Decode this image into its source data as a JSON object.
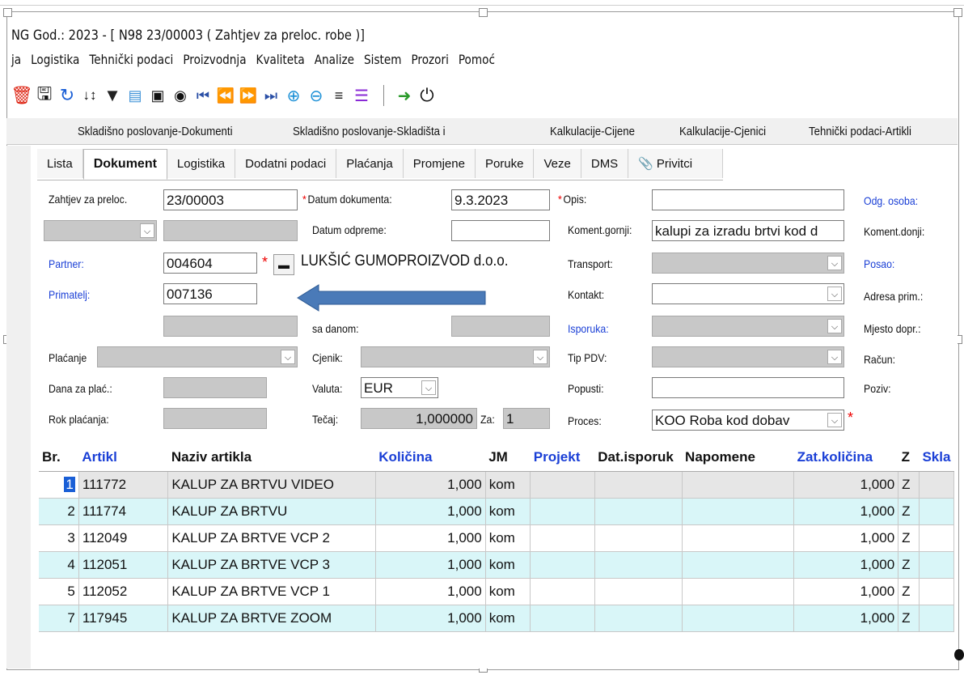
{
  "window": {
    "title": "NG God.: 2023 - [ N98 23/00003  ( Zahtjev za preloc. robe )]"
  },
  "menu": [
    "ja",
    "Logistika",
    "Tehnički podaci",
    "Proizvodnja",
    "Kvaliteta",
    "Analize",
    "Sistem",
    "Prozori",
    "Pomoć"
  ],
  "toolbar": {
    "icons": [
      "delete-icon",
      "save-icon",
      "refresh-icon",
      "sort-icon",
      "filter-icon",
      "edit-grid-icon",
      "layout-icon",
      "view-icon",
      "first-icon",
      "prev-icon",
      "next-icon",
      "last-icon",
      "zoom-in-icon",
      "zoom-out-icon",
      "align-icon",
      "list-icon",
      "exit-icon",
      "power-icon"
    ]
  },
  "window_tabs": [
    "Skladišno poslovanje-Dokumenti",
    "Skladišno poslovanje-Skladišta i",
    "Kalkulacije-Cijene",
    "Kalkulacije-Cjenici",
    "Tehnički podaci-Artikli"
  ],
  "tabs": [
    "Lista",
    "Dokument",
    "Logistika",
    "Dodatni podaci",
    "Plaćanja",
    "Promjene",
    "Poruke",
    "Veze",
    "DMS",
    "Privitci"
  ],
  "form": {
    "zahtjev_label": "Zahtjev za preloc.",
    "zahtjev_value": "23/00003",
    "partner_label": "Partner:",
    "partner_value": "004604",
    "partner_name": "LUKŠIĆ GUMOPROIZVOD d.o.o.",
    "primatelj_label": "Primatelj:",
    "primatelj_value": "007136",
    "placanje_label": "Plaćanje",
    "dana_label": "Dana za plać.:",
    "rok_label": "Rok plaćanja:",
    "datum_dok_label": "Datum dokumenta:",
    "datum_dok_value": "9.3.2023",
    "datum_odpreme_label": "Datum odpreme:",
    "sa_danom_label": "sa danom:",
    "cjenik_label": "Cjenik:",
    "valuta_label": "Valuta:",
    "valuta_value": "EUR",
    "tecaj_label": "Tečaj:",
    "tecaj_value": "1,000000",
    "za_label": "Za:",
    "za_value": "1",
    "opis_label": "Opis:",
    "koment_gornji_label": "Koment.gornji:",
    "koment_gornji_value": "kalupi za izradu brtvi kod d",
    "transport_label": "Transport:",
    "kontakt_label": "Kontakt:",
    "isporuka_label": "Isporuka:",
    "tip_pdv_label": "Tip PDV:",
    "popusti_label": "Popusti:",
    "proces_label": "Proces:",
    "proces_value": "KOO  Roba kod dobav",
    "odg_osoba_label": "Odg. osoba:",
    "koment_donji_label": "Koment.donji:",
    "posao_label": "Posao:",
    "adresa_prim_label": "Adresa prim.:",
    "mjesto_dopr_label": "Mjesto dopr.:",
    "racun_label": "Račun:",
    "poziv_label": "Poziv:"
  },
  "colors": {
    "link_blue": "#1a3fd6",
    "row_cyan": "#d9f6f8",
    "required_red": "#e00000",
    "arrow_blue": "#4a7ab8"
  },
  "grid": {
    "columns": [
      "Br.",
      "Artikl",
      "Naziv artikla",
      "Količina",
      "JM",
      "Projekt",
      "Dat.isporuk",
      "Napomene",
      "Zat.količina",
      "Z",
      "Skla"
    ],
    "rows": [
      {
        "br": "1",
        "artikl": "111772",
        "naziv": "KALUP ZA BRTVU VIDEO",
        "kolicina": "1,000",
        "jm": "kom",
        "zat": "1,000",
        "z": "Z"
      },
      {
        "br": "2",
        "artikl": "111774",
        "naziv": "KALUP ZA BRTVU",
        "kolicina": "1,000",
        "jm": "kom",
        "zat": "1,000",
        "z": "Z"
      },
      {
        "br": "3",
        "artikl": "112049",
        "naziv": "KALUP ZA BRTVE VCP 2",
        "kolicina": "1,000",
        "jm": "kom",
        "zat": "1,000",
        "z": "Z"
      },
      {
        "br": "4",
        "artikl": "112051",
        "naziv": "KALUP ZA BRTVE VCP 3",
        "kolicina": "1,000",
        "jm": "kom",
        "zat": "1,000",
        "z": "Z"
      },
      {
        "br": "5",
        "artikl": "112052",
        "naziv": "KALUP ZA BRTVE VCP 1",
        "kolicina": "1,000",
        "jm": "kom",
        "zat": "1,000",
        "z": "Z"
      },
      {
        "br": "7",
        "artikl": "117945",
        "naziv": "KALUP ZA BRTVE ZOOM",
        "kolicina": "1,000",
        "jm": "kom",
        "zat": "1,000",
        "z": "Z"
      }
    ]
  }
}
